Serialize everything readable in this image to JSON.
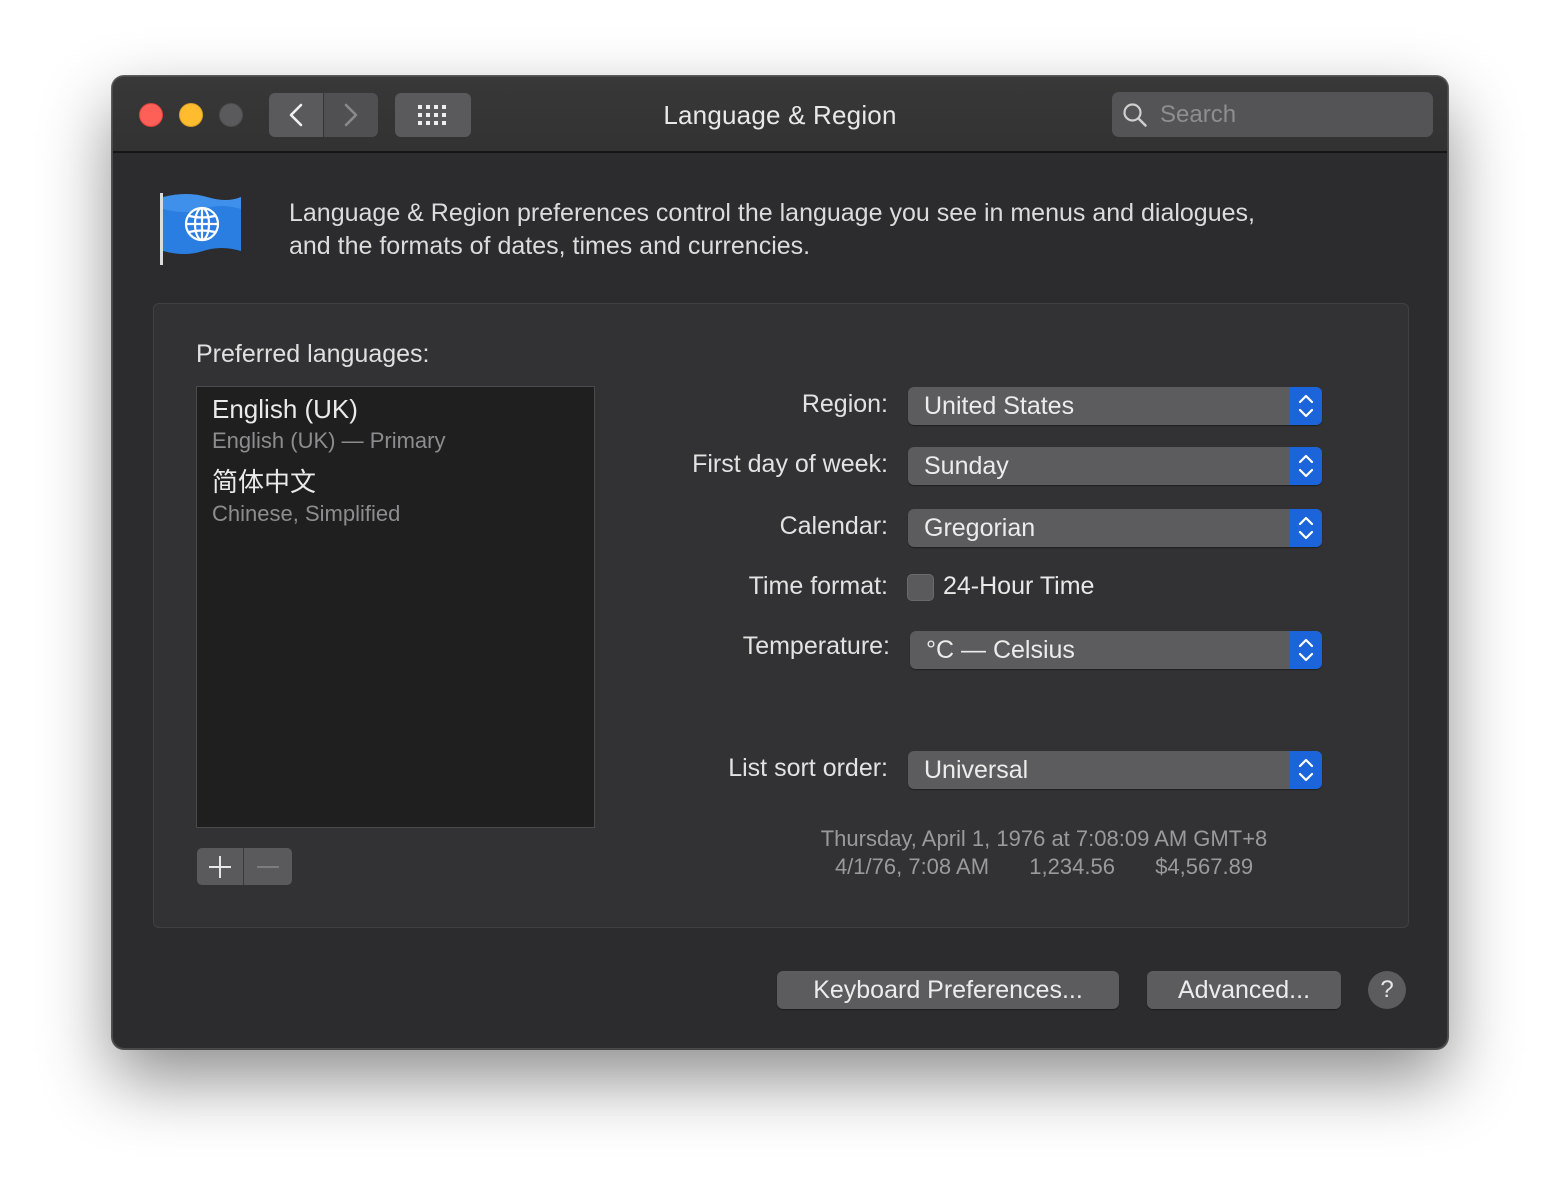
{
  "window": {
    "title": "Language & Region",
    "search_placeholder": "Search"
  },
  "header": {
    "description_line1": "Language & Region preferences control the language you see in menus and dialogues,",
    "description_line2": "and the formats of dates, times and currencies."
  },
  "languages": {
    "label": "Preferred languages:",
    "items": [
      {
        "name": "English (UK)",
        "sub": "English (UK) — Primary"
      },
      {
        "name": "简体中文",
        "sub": "Chinese, Simplified"
      }
    ]
  },
  "settings": {
    "region": {
      "label": "Region:",
      "value": "United States"
    },
    "first_day": {
      "label": "First day of week:",
      "value": "Sunday"
    },
    "calendar": {
      "label": "Calendar:",
      "value": "Gregorian"
    },
    "time_format": {
      "label": "Time format:",
      "checkbox_label": "24-Hour Time",
      "checked": false
    },
    "temperature": {
      "label": "Temperature:",
      "value": "°C — Celsius"
    },
    "sort_order": {
      "label": "List sort order:",
      "value": "Universal"
    }
  },
  "sample": {
    "line1": "Thursday, April 1, 1976 at 7:08:09 AM GMT+8",
    "date_short": "4/1/76, 7:08 AM",
    "number": "1,234.56",
    "currency": "$4,567.89"
  },
  "buttons": {
    "keyboard": "Keyboard Preferences...",
    "advanced": "Advanced...",
    "help": "?"
  },
  "colors": {
    "window_bg": "#2c2c2e",
    "accent": "#1b64da",
    "close": "#fe5f57",
    "minimize": "#febc2e"
  },
  "icons": {
    "back": "chevron-left-icon",
    "forward": "chevron-right-icon",
    "grid": "grid-icon",
    "search": "search-icon",
    "header": "globe-flag-icon",
    "popup": "updown-chevron-icon"
  }
}
